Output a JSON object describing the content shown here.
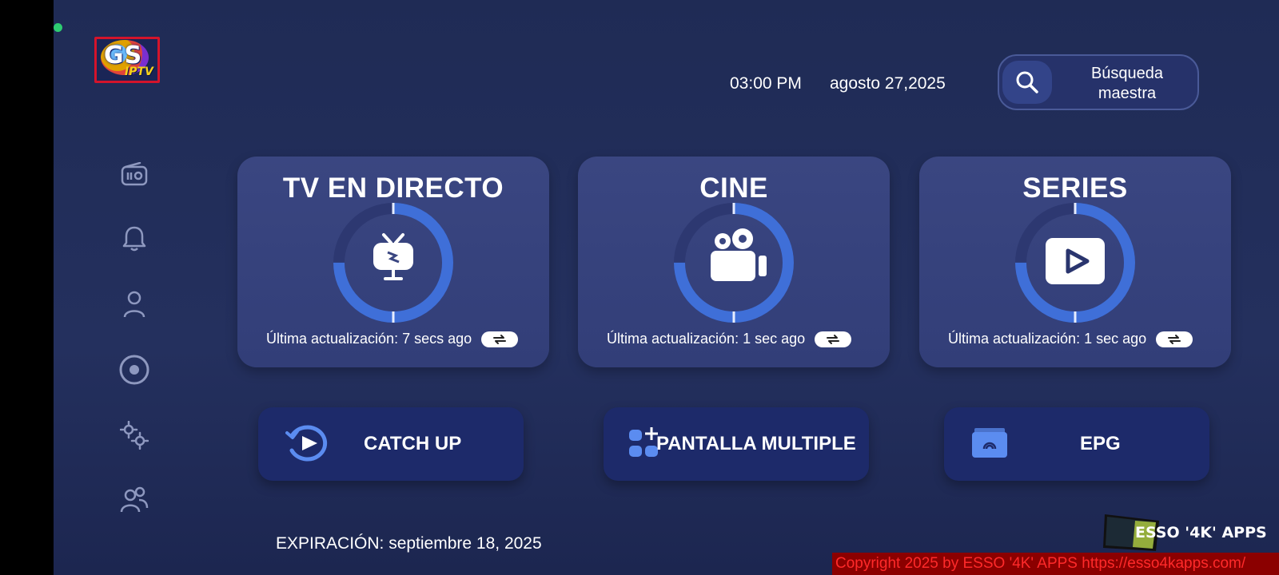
{
  "app": {
    "logo_main": "GS",
    "logo_sub": "IPTV"
  },
  "header": {
    "time": "03:00 PM",
    "date": "agosto 27,2025",
    "search_label_line1": "Búsqueda",
    "search_label_line2": "maestra"
  },
  "sidebar": {
    "items": [
      {
        "icon": "radio-icon"
      },
      {
        "icon": "bell-icon"
      },
      {
        "icon": "user-icon"
      },
      {
        "icon": "record-icon"
      },
      {
        "icon": "settings-icon"
      },
      {
        "icon": "users-icon"
      }
    ]
  },
  "cards": [
    {
      "title": "TV EN DIRECTO",
      "update": "Última actualización: 7 secs ago",
      "icon": "tv-icon",
      "progress": 0.75
    },
    {
      "title": "CINE",
      "update": "Última actualización: 1 sec ago",
      "icon": "movie-camera-icon",
      "progress": 0.75
    },
    {
      "title": "SERIES",
      "update": "Última actualización: 1 sec ago",
      "icon": "play-icon",
      "progress": 0.75
    }
  ],
  "actions": [
    {
      "label": "CATCH UP",
      "icon": "catch-up-icon"
    },
    {
      "label": "PANTALLA MULTIPLE",
      "icon": "multi-screen-icon"
    },
    {
      "label": "EPG",
      "icon": "epg-icon"
    }
  ],
  "footer": {
    "expiry": "EXPIRACIÓN: septiembre 18, 2025",
    "brand": "ESSO '4K' APPS",
    "copyright": "Copyright 2025  by ESSO '4K' APPS https://esso4kapps.com/"
  },
  "colors": {
    "accent": "#3f6fd8",
    "card": "#364380",
    "action": "#1d2a6a",
    "copyright_bg": "#8b0000",
    "copyright_text": "#ff2a2a"
  }
}
